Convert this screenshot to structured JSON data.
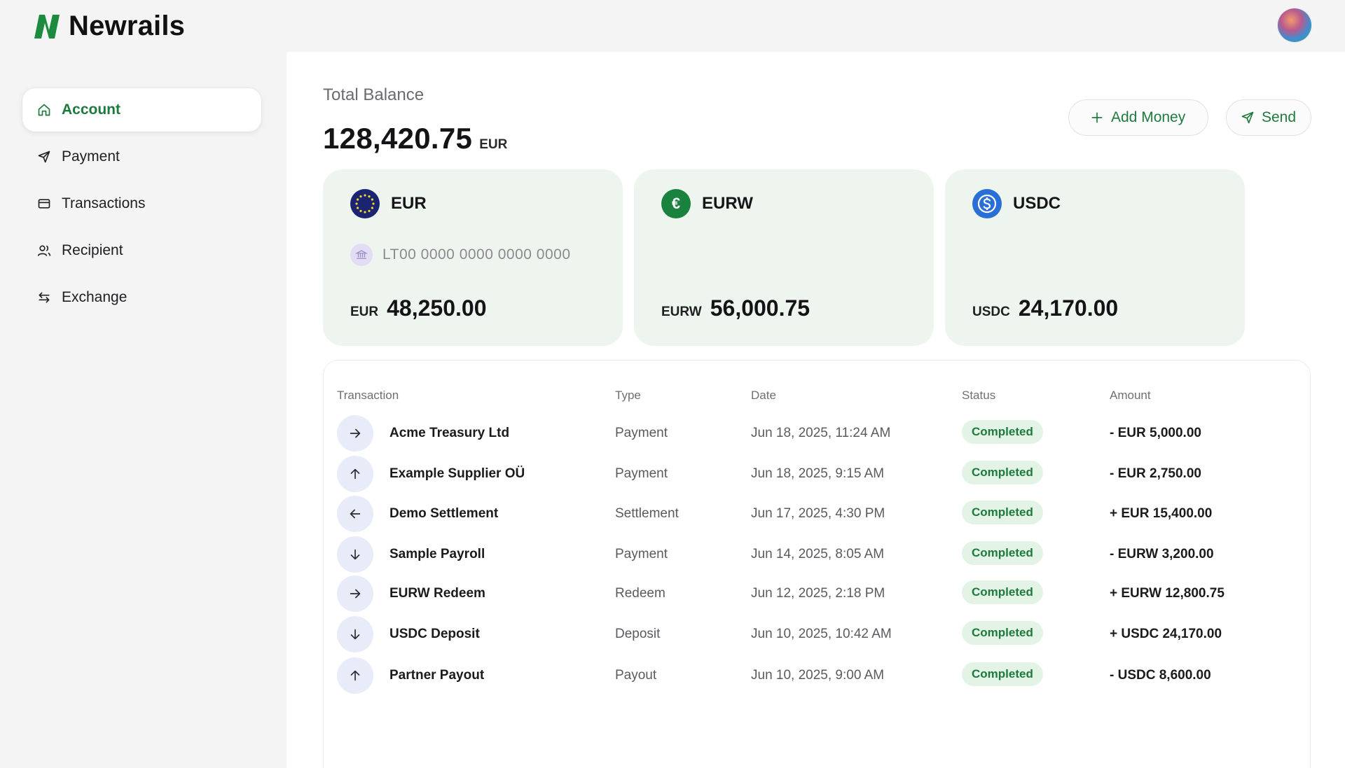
{
  "brand": {
    "name": "Newrails",
    "accent": "#1c7a3c"
  },
  "sidebar": {
    "items": [
      {
        "label": "Account",
        "icon": "home-icon",
        "active": true
      },
      {
        "label": "Payment",
        "icon": "send-icon",
        "active": false
      },
      {
        "label": "Transactions",
        "icon": "card-icon",
        "active": false
      },
      {
        "label": "Recipient",
        "icon": "users-icon",
        "active": false
      },
      {
        "label": "Exchange",
        "icon": "exchange-icon",
        "active": false
      }
    ]
  },
  "balance": {
    "label": "Total Balance",
    "value": "128,420.75",
    "currency": "EUR"
  },
  "actions": {
    "add_money": "Add Money",
    "send": "Send"
  },
  "cards": [
    {
      "name": "EUR",
      "iban": "LT00 0000 0000 0000 0000",
      "currency": "EUR",
      "amount": "48,250.00",
      "icon": "eu-flag-icon"
    },
    {
      "name": "EURW",
      "currency": "EURW",
      "amount": "56,000.75",
      "icon": "euro-coin-icon",
      "symbol": "€"
    },
    {
      "name": "USDC",
      "currency": "USDC",
      "amount": "24,170.00",
      "icon": "usdc-coin-icon"
    }
  ],
  "table": {
    "headers": {
      "transaction": "Transaction",
      "type": "Type",
      "date": "Date",
      "status": "Status",
      "amount": "Amount"
    },
    "rows": [
      {
        "name": "Acme Treasury Ltd",
        "type": "Payment",
        "date": "Jun 18, 2025, 11:24 AM",
        "status": "Completed",
        "amount": "- EUR 5,000.00",
        "icon": "arrow-right-icon"
      },
      {
        "name": "Example Supplier OÜ",
        "type": "Payment",
        "date": "Jun 18, 2025, 9:15 AM",
        "status": "Completed",
        "amount": "- EUR 2,750.00",
        "icon": "arrow-up-icon"
      },
      {
        "name": "Demo Settlement",
        "type": "Settlement",
        "date": "Jun 17, 2025, 4:30 PM",
        "status": "Completed",
        "amount": "+ EUR 15,400.00",
        "icon": "arrow-left-icon"
      },
      {
        "name": "Sample Payroll",
        "type": "Payment",
        "date": "Jun 14, 2025, 8:05 AM",
        "status": "Completed",
        "amount": "- EURW 3,200.00",
        "icon": "arrow-down-icon"
      },
      {
        "name": "EURW Redeem",
        "type": "Redeem",
        "date": "Jun 12, 2025, 2:18 PM",
        "status": "Completed",
        "amount": "+ EURW 12,800.75",
        "icon": "arrow-right-icon"
      },
      {
        "name": "USDC Deposit",
        "type": "Deposit",
        "date": "Jun 10, 2025, 10:42 AM",
        "status": "Completed",
        "amount": "+ USDC 24,170.00",
        "icon": "arrow-down-icon"
      },
      {
        "name": "Partner Payout",
        "type": "Payout",
        "date": "Jun 10, 2025, 9:00 AM",
        "status": "Completed",
        "amount": "- USDC 8,600.00",
        "icon": "arrow-up-icon"
      }
    ]
  }
}
